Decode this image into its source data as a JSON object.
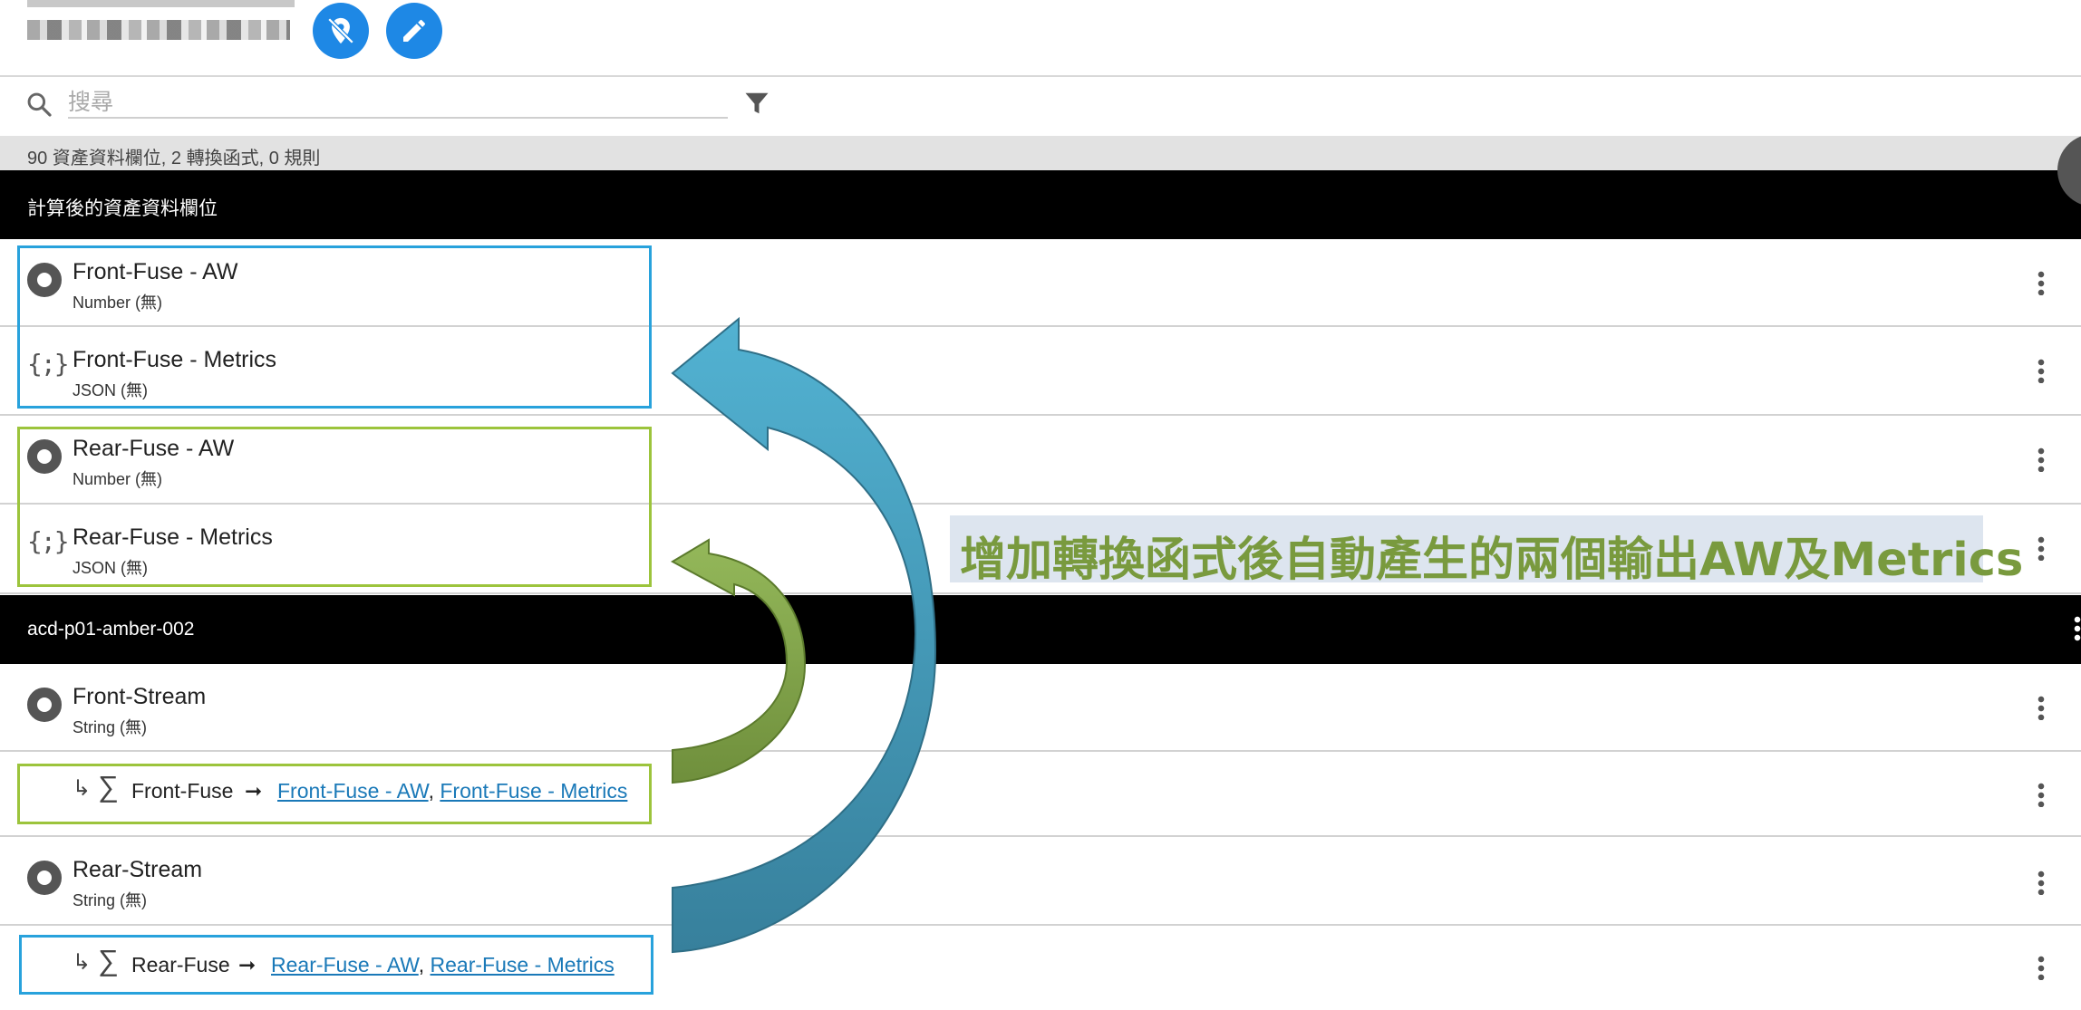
{
  "header": {
    "blurred_title": "",
    "location_button_icon": "location-off-icon",
    "edit_button_icon": "pencil-icon"
  },
  "search": {
    "placeholder": "搜尋",
    "value": ""
  },
  "summary": "90 資產資料欄位, 2 轉換函式, 0 規則",
  "groups": [
    {
      "title": "計算後的資產資料欄位",
      "rows": [
        {
          "icon": "circle-icon",
          "title": "Front-Fuse - AW",
          "type": "Number (無)"
        },
        {
          "icon": "json-braces-icon",
          "icon_glyph": "{;}",
          "title": "Front-Fuse - Metrics",
          "type": "JSON (無)"
        },
        {
          "icon": "circle-icon",
          "title": "Rear-Fuse - AW",
          "type": "Number (無)"
        },
        {
          "icon": "json-braces-icon",
          "icon_glyph": "{;}",
          "title": "Rear-Fuse - Metrics",
          "type": "JSON (無)"
        }
      ]
    },
    {
      "title": "acd-p01-amber-002",
      "rows": [
        {
          "icon": "circle-icon",
          "title": "Front-Stream",
          "type": "String (無)"
        },
        {
          "function": {
            "arrow": "↳",
            "sigma": "∑",
            "name": "Front-Fuse",
            "map_arrow": "➞",
            "outputs": [
              "Front-Fuse - AW",
              "Front-Fuse - Metrics"
            ],
            "sep": ", "
          }
        },
        {
          "icon": "circle-icon",
          "title": "Rear-Stream",
          "type": "String (無)"
        },
        {
          "function": {
            "arrow": "↳",
            "sigma": "∑",
            "name": "Rear-Fuse",
            "map_arrow": "➞",
            "outputs": [
              "Rear-Fuse - AW",
              "Rear-Fuse - Metrics"
            ],
            "sep": ", "
          }
        }
      ]
    }
  ],
  "annotation": "增加轉換函式後自動產生的兩個輸出AW及Metrics",
  "colors": {
    "primary_button": "#1e88e5",
    "highlight_blue": "#28a2dc",
    "highlight_green": "#9cc43c",
    "arrow_blue": "#3f9fc0",
    "arrow_green": "#7f9f45",
    "annotation_text": "#799a3e",
    "annotation_bg": "#dde5ef"
  }
}
